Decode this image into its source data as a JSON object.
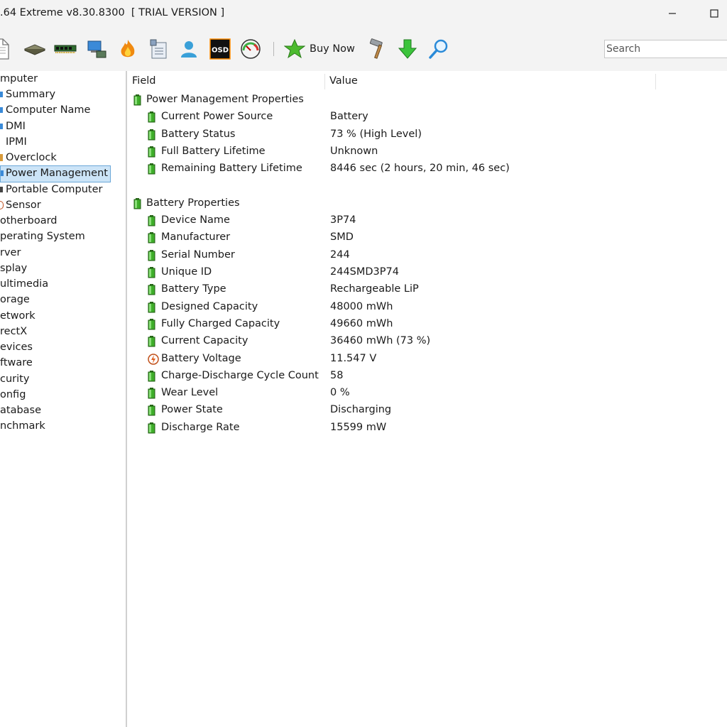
{
  "window": {
    "title": ".64 Extreme v8.30.8300  [ TRIAL VERSION ]"
  },
  "toolbar": {
    "icons": [
      "report-icon",
      "motherboard-icon",
      "memory-icon",
      "network-icon",
      "flame-icon",
      "clipboard-icon",
      "user-icon",
      "osd-icon",
      "gauge-icon"
    ],
    "osd_label": "OSD",
    "buy_now_label": "Buy Now",
    "search_placeholder": "Search"
  },
  "sidebar": {
    "items": [
      {
        "label": "mputer",
        "icon": ""
      },
      {
        "label": "Summary",
        "icon": "summary-icon"
      },
      {
        "label": "Computer Name",
        "icon": "computer-name-icon"
      },
      {
        "label": "DMI",
        "icon": "dmi-icon"
      },
      {
        "label": "IPMI",
        "icon": ""
      },
      {
        "label": "Overclock",
        "icon": "overclock-icon"
      },
      {
        "label": "Power Management",
        "icon": "power-management-icon",
        "selected": true
      },
      {
        "label": "Portable Computer",
        "icon": "portable-computer-icon"
      },
      {
        "label": "Sensor",
        "icon": "sensor-icon"
      },
      {
        "label": "otherboard",
        "icon": ""
      },
      {
        "label": "perating System",
        "icon": ""
      },
      {
        "label": "rver",
        "icon": ""
      },
      {
        "label": "splay",
        "icon": ""
      },
      {
        "label": "ultimedia",
        "icon": ""
      },
      {
        "label": "orage",
        "icon": ""
      },
      {
        "label": "etwork",
        "icon": ""
      },
      {
        "label": "rectX",
        "icon": ""
      },
      {
        "label": "evices",
        "icon": ""
      },
      {
        "label": "ftware",
        "icon": ""
      },
      {
        "label": "curity",
        "icon": ""
      },
      {
        "label": "onfig",
        "icon": ""
      },
      {
        "label": "atabase",
        "icon": ""
      },
      {
        "label": "nchmark",
        "icon": ""
      }
    ]
  },
  "details": {
    "columns": {
      "field": "Field",
      "value": "Value"
    },
    "sections": [
      {
        "title": "Power Management Properties",
        "icon": "battery-icon",
        "rows": [
          {
            "field": "Current Power Source",
            "value": "Battery",
            "icon": "battery-icon"
          },
          {
            "field": "Battery Status",
            "value": "73 % (High Level)",
            "icon": "battery-icon"
          },
          {
            "field": "Full Battery Lifetime",
            "value": "Unknown",
            "icon": "battery-icon"
          },
          {
            "field": "Remaining Battery Lifetime",
            "value": "8446 sec (2 hours, 20 min, 46 sec)",
            "icon": "battery-icon"
          }
        ]
      },
      {
        "title": "Battery Properties",
        "icon": "battery-icon",
        "rows": [
          {
            "field": "Device Name",
            "value": "3P74",
            "icon": "battery-icon"
          },
          {
            "field": "Manufacturer",
            "value": "SMD",
            "icon": "battery-icon"
          },
          {
            "field": "Serial Number",
            "value": "244",
            "icon": "battery-icon"
          },
          {
            "field": "Unique ID",
            "value": "244SMD3P74",
            "icon": "battery-icon"
          },
          {
            "field": "Battery Type",
            "value": "Rechargeable LiP",
            "icon": "battery-icon"
          },
          {
            "field": "Designed Capacity",
            "value": "48000 mWh",
            "icon": "battery-icon"
          },
          {
            "field": "Fully Charged Capacity",
            "value": "49660 mWh",
            "icon": "battery-icon"
          },
          {
            "field": "Current Capacity",
            "value": "36460 mWh  (73 %)",
            "icon": "battery-icon"
          },
          {
            "field": "Battery Voltage",
            "value": "11.547 V",
            "icon": "voltage-icon"
          },
          {
            "field": "Charge-Discharge Cycle Count",
            "value": "58",
            "icon": "battery-icon"
          },
          {
            "field": "Wear Level",
            "value": "0 %",
            "icon": "battery-icon"
          },
          {
            "field": "Power State",
            "value": "Discharging",
            "icon": "battery-icon"
          },
          {
            "field": "Discharge Rate",
            "value": "15599 mW",
            "icon": "battery-icon"
          }
        ]
      }
    ]
  }
}
